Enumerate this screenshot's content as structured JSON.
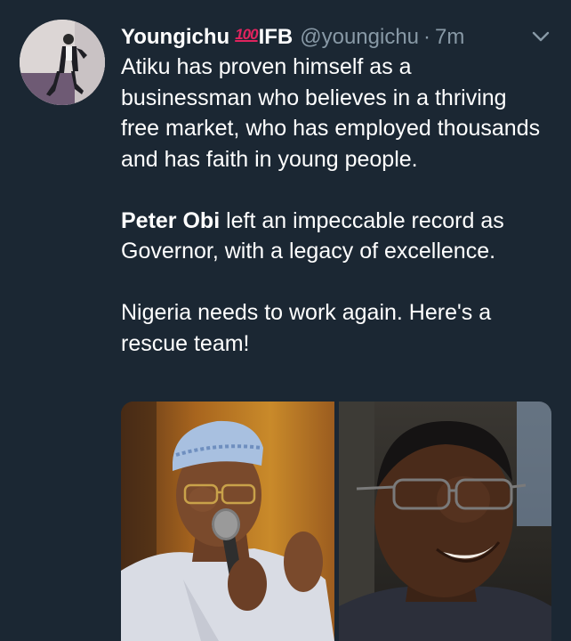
{
  "tweet": {
    "display_name": "Youngichu",
    "name_emoji": "100",
    "name_suffix": "IFB",
    "handle": "@youngichu",
    "separator": "·",
    "time": "7m",
    "paragraph1": "Atiku has proven himself as a businessman who believes in a thriving free market, who has employed thousands and has faith in young people.",
    "paragraph2_bold": "Peter Obi",
    "paragraph2_rest": " left an impeccable record as Governor, with a legacy of excellence.",
    "paragraph3": "Nigeria needs to work again. Here's a rescue team!"
  },
  "icons": {
    "menu": "chevron-down-icon"
  },
  "colors": {
    "background": "#1b2733",
    "secondary_text": "#8899a6",
    "primary_text": "#ffffff",
    "emoji_red": "#e0245e"
  }
}
